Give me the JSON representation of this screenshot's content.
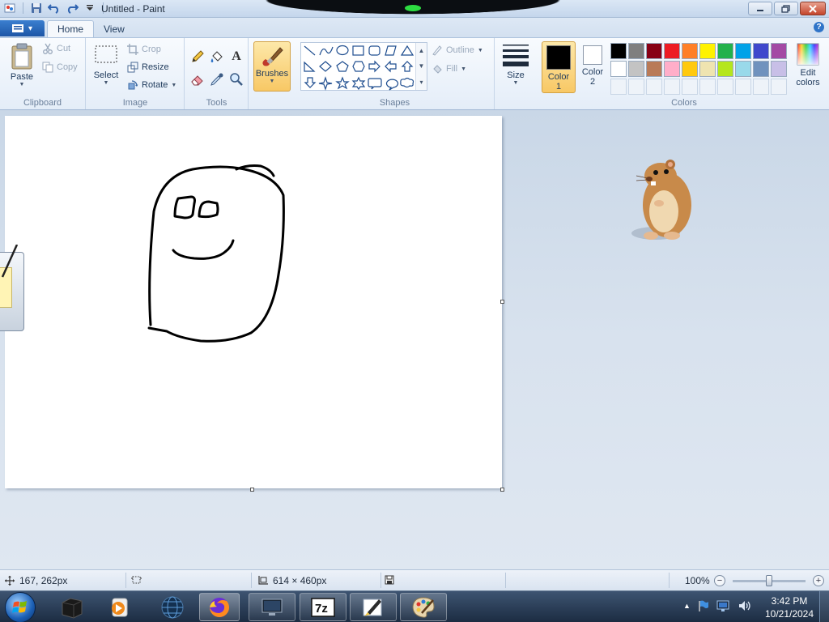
{
  "titlebar": {
    "title": "Untitled - Paint",
    "qa_icons": [
      "paint-app-icon",
      "save-icon",
      "undo-icon",
      "redo-icon",
      "customize-quick-access-icon"
    ],
    "controls": [
      "minimize",
      "maximize",
      "close"
    ]
  },
  "tabs": {
    "home": "Home",
    "view": "View"
  },
  "ribbon": {
    "clipboard": {
      "label": "Clipboard",
      "paste": "Paste",
      "cut": "Cut",
      "copy": "Copy"
    },
    "image": {
      "label": "Image",
      "select": "Select",
      "crop": "Crop",
      "resize": "Resize",
      "rotate": "Rotate"
    },
    "tools": {
      "label": "Tools",
      "items": [
        "pencil-icon",
        "fill-icon",
        "text-icon",
        "eraser-icon",
        "color-picker-icon",
        "magnifier-icon"
      ],
      "text_glyph": "A"
    },
    "brushes": {
      "label": "Brushes"
    },
    "shapes": {
      "label": "Shapes",
      "outline": "Outline",
      "fill": "Fill"
    },
    "size": {
      "label": "Size"
    },
    "colors": {
      "label": "Colors",
      "color1_line1": "Color",
      "color1_line2": "1",
      "color2_line1": "Color",
      "color2_line2": "2",
      "color1": "#000000",
      "color2": "#ffffff",
      "edit_line1": "Edit",
      "edit_line2": "colors",
      "palette_row1": [
        "#000000",
        "#7f7f7f",
        "#880015",
        "#ed1c24",
        "#ff7f27",
        "#fff200",
        "#22b14c",
        "#00a2e8",
        "#3f48cc",
        "#a349a4"
      ],
      "palette_row2": [
        "#ffffff",
        "#c3c3c3",
        "#b97a57",
        "#ffaec9",
        "#ffc90e",
        "#efe4b0",
        "#b5e61d",
        "#99d9ea",
        "#7092be",
        "#c8bfe7"
      ]
    }
  },
  "status": {
    "cursor_pos": "167, 262px",
    "selection_size": "",
    "canvas_size": "614 × 460px",
    "zoom": "100%",
    "zoom_fraction": 0.5
  },
  "taskbar": {
    "time": "3:42 PM",
    "date": "10/21/2024",
    "apps": [
      "black-box-app-icon",
      "media-player-icon",
      "globe-app-icon",
      "firefox-icon",
      "monitor-app-icon",
      "7zip-icon",
      "notepad-pen-icon",
      "paint-palette-icon"
    ]
  }
}
